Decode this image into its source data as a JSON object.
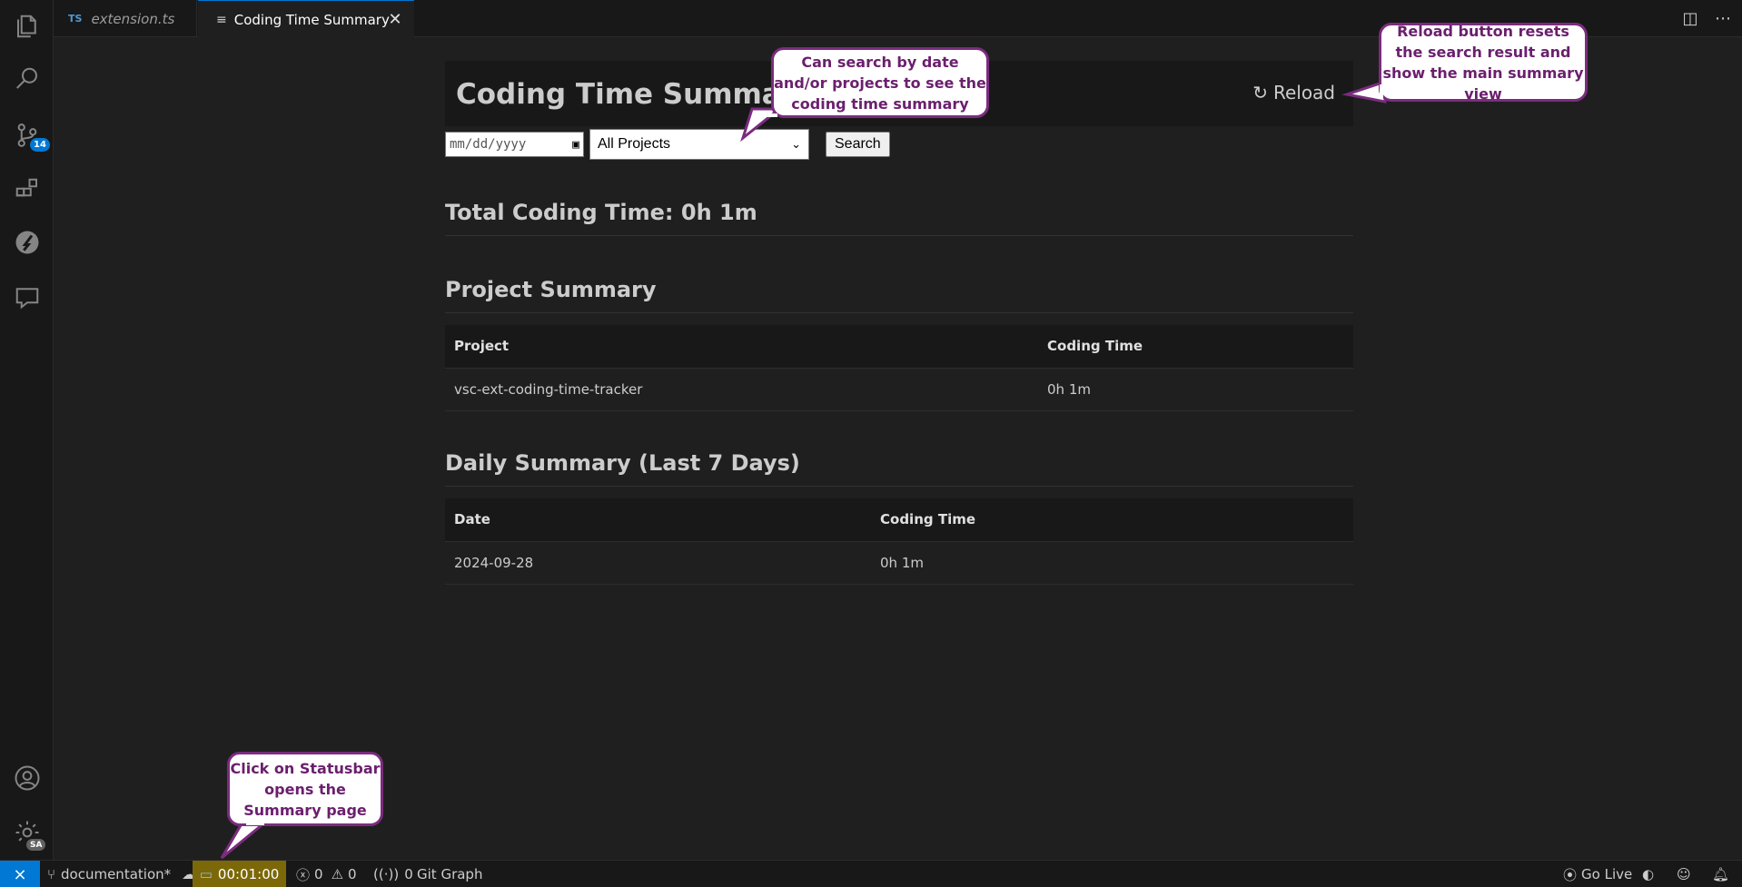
{
  "tabs": [
    {
      "prefix": "TS",
      "label": "extension.ts"
    },
    {
      "label": "Coding Time Summary"
    }
  ],
  "activity_icons": [
    "files-icon",
    "search-icon",
    "source-control-icon",
    "extensions-icon",
    "git-graph-icon",
    "comments-icon",
    "account-icon",
    "manage-gear-icon"
  ],
  "scm_badge": "14",
  "account_badge": "SA",
  "page": {
    "title": "Coding Time Summary",
    "reload_icon": "↻",
    "reload_label": "Reload",
    "date_placeholder": "mm/dd/yyyy",
    "project_select": "All Projects",
    "search_label": "Search",
    "total": "Total Coding Time: 0h 1m",
    "project_summary": {
      "title": "Project Summary",
      "headers": [
        "Project",
        "Coding Time"
      ],
      "rows": [
        [
          "vsc-ext-coding-time-tracker",
          "0h 1m"
        ]
      ]
    },
    "daily_summary": {
      "title": "Daily Summary (Last 7 Days)",
      "headers": [
        "Date",
        "Coding Time"
      ],
      "rows": [
        [
          "2024-09-28",
          "0h 1m"
        ]
      ]
    }
  },
  "callouts": {
    "search": "Can search by date and/or projects to see the coding time summary",
    "reload": "Reload button resets the search result and show the main summary view",
    "statusbar": "Click on Statusbar opens the Summary page"
  },
  "statusbar": {
    "branch": "documentation*",
    "timer": "00:01:00",
    "errors": "0",
    "warnings": "0",
    "ports": "0",
    "git_graph": "Git Graph",
    "go_live": "Go Live"
  },
  "colors": {
    "accent": "#0078d4",
    "timer_bg": "#7c6808",
    "callout_border": "#7b2c7e",
    "callout_text": "#6b1f6e"
  }
}
